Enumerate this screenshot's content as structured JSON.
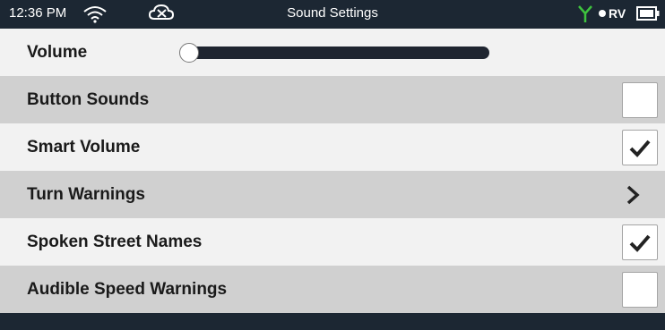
{
  "status_bar": {
    "time": "12:36 PM",
    "title": "Sound Settings",
    "mode": "RV",
    "wifi_icon": "wifi-icon",
    "cloud_icon": "cloud-off-icon",
    "signal_icon": "antenna-signal-icon",
    "battery_icon": "battery-icon",
    "signal_color": "#3ec23e"
  },
  "settings": {
    "volume": {
      "label": "Volume",
      "level": 0
    },
    "button_sounds": {
      "label": "Button Sounds",
      "checked": false
    },
    "smart_volume": {
      "label": "Smart Volume",
      "checked": true
    },
    "turn_warnings": {
      "label": "Turn Warnings",
      "icon": "chevron-right-icon"
    },
    "spoken_street_names": {
      "label": "Spoken Street Names",
      "checked": true
    },
    "audible_speed_warnings": {
      "label": "Audible Speed Warnings",
      "checked": false
    }
  }
}
